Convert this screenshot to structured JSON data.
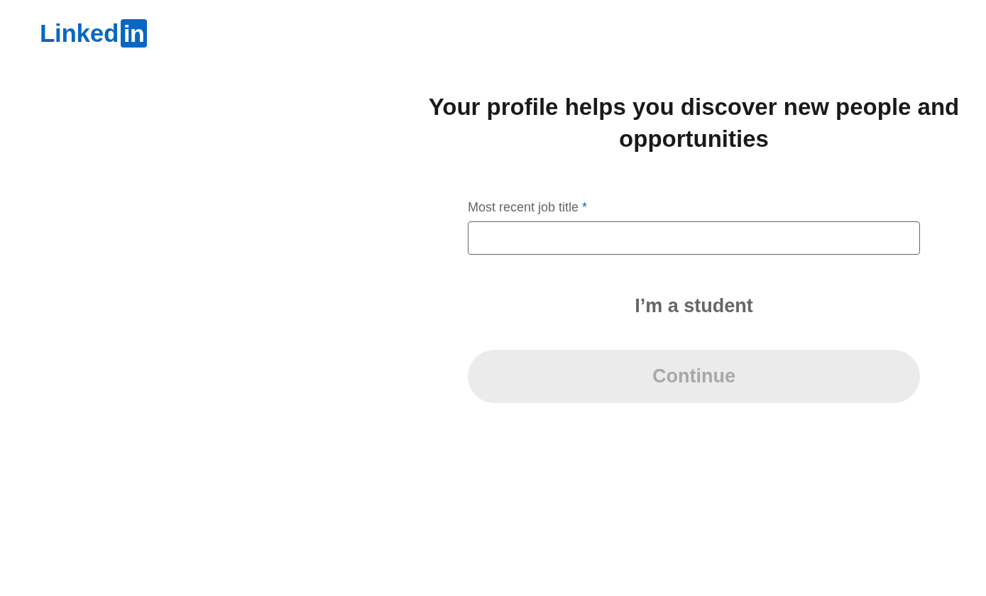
{
  "logo": {
    "word": "Linked",
    "badge": "in"
  },
  "heading": "Your profile helps you discover new people and opportunities",
  "field": {
    "label": "Most recent job title",
    "required_mark": "*"
  },
  "student_link": "I’m a student",
  "continue_button": {
    "label": "Continue",
    "disabled": true
  }
}
